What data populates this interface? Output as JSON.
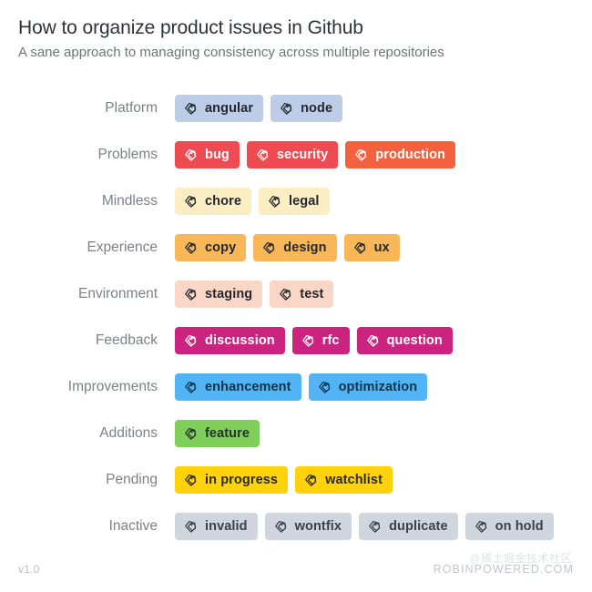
{
  "header": {
    "title": "How to organize product issues in Github",
    "subtitle": "A sane approach to managing consistency across multiple repositories"
  },
  "icon": {
    "name": "tags-icon"
  },
  "groups": [
    {
      "label": "Platform",
      "tags": [
        {
          "text": "angular",
          "bg": "#BDCDE8",
          "fg": "#23282e"
        },
        {
          "text": "node",
          "bg": "#BDCDE8",
          "fg": "#23282e"
        }
      ]
    },
    {
      "label": "Problems",
      "tags": [
        {
          "text": "bug",
          "bg": "#EE4B52",
          "fg": "#ffffff"
        },
        {
          "text": "security",
          "bg": "#EE4B52",
          "fg": "#ffffff"
        },
        {
          "text": "production",
          "bg": "#F4613F",
          "fg": "#ffffff"
        }
      ]
    },
    {
      "label": "Mindless",
      "tags": [
        {
          "text": "chore",
          "bg": "#FCEEC3",
          "fg": "#23282e"
        },
        {
          "text": "legal",
          "bg": "#FCEEC3",
          "fg": "#23282e"
        }
      ]
    },
    {
      "label": "Experience",
      "tags": [
        {
          "text": "copy",
          "bg": "#FAB757",
          "fg": "#23282e"
        },
        {
          "text": "design",
          "bg": "#FAB757",
          "fg": "#23282e"
        },
        {
          "text": "ux",
          "bg": "#FAB757",
          "fg": "#23282e"
        }
      ]
    },
    {
      "label": "Environment",
      "tags": [
        {
          "text": "staging",
          "bg": "#F9D6C6",
          "fg": "#23282e"
        },
        {
          "text": "test",
          "bg": "#F9D6C6",
          "fg": "#23282e"
        }
      ]
    },
    {
      "label": "Feedback",
      "tags": [
        {
          "text": "discussion",
          "bg": "#CA2380",
          "fg": "#ffffff"
        },
        {
          "text": "rfc",
          "bg": "#CA2380",
          "fg": "#ffffff"
        },
        {
          "text": "question",
          "bg": "#CA2380",
          "fg": "#ffffff"
        }
      ]
    },
    {
      "label": "Improvements",
      "tags": [
        {
          "text": "enhancement",
          "bg": "#50B4F5",
          "fg": "#12324a"
        },
        {
          "text": "optimization",
          "bg": "#50B4F5",
          "fg": "#12324a"
        }
      ]
    },
    {
      "label": "Additions",
      "tags": [
        {
          "text": "feature",
          "bg": "#80CF5A",
          "fg": "#23332b"
        }
      ]
    },
    {
      "label": "Pending",
      "tags": [
        {
          "text": "in progress",
          "bg": "#FFD20A",
          "fg": "#2b2a20"
        },
        {
          "text": "watchlist",
          "bg": "#FFD20A",
          "fg": "#2b2a20"
        }
      ]
    },
    {
      "label": "Inactive",
      "tags": [
        {
          "text": "invalid",
          "bg": "#CFD6DD",
          "fg": "#3b4148"
        },
        {
          "text": "wontfix",
          "bg": "#CFD6DD",
          "fg": "#3b4148"
        },
        {
          "text": "duplicate",
          "bg": "#CFD6DD",
          "fg": "#3b4148"
        },
        {
          "text": "on hold",
          "bg": "#CFD6DD",
          "fg": "#3b4148"
        }
      ]
    }
  ],
  "footer": {
    "version": "v1.0",
    "brand": "ROBINPOWERED.COM",
    "watermark": "@稀土掘金技术社区"
  }
}
